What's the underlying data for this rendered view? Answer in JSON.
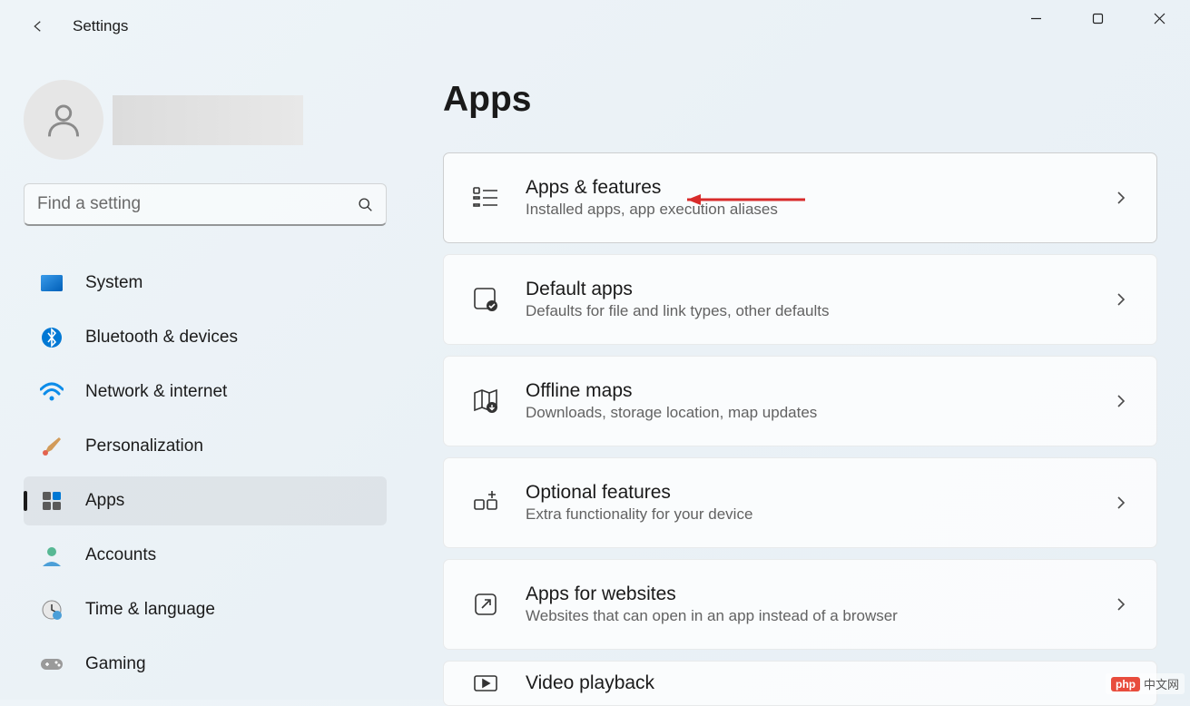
{
  "app_title": "Settings",
  "search": {
    "placeholder": "Find a setting"
  },
  "nav": [
    {
      "label": "System",
      "icon": "system"
    },
    {
      "label": "Bluetooth & devices",
      "icon": "bluetooth"
    },
    {
      "label": "Network & internet",
      "icon": "wifi"
    },
    {
      "label": "Personalization",
      "icon": "brush"
    },
    {
      "label": "Apps",
      "icon": "apps",
      "active": true
    },
    {
      "label": "Accounts",
      "icon": "account"
    },
    {
      "label": "Time & language",
      "icon": "time"
    },
    {
      "label": "Gaming",
      "icon": "gaming"
    }
  ],
  "page_title": "Apps",
  "cards": [
    {
      "title": "Apps & features",
      "desc": "Installed apps, app execution aliases",
      "icon": "apps-list",
      "highlighted": true,
      "arrow": true
    },
    {
      "title": "Default apps",
      "desc": "Defaults for file and link types, other defaults",
      "icon": "default-apps"
    },
    {
      "title": "Offline maps",
      "desc": "Downloads, storage location, map updates",
      "icon": "map"
    },
    {
      "title": "Optional features",
      "desc": "Extra functionality for your device",
      "icon": "optional"
    },
    {
      "title": "Apps for websites",
      "desc": "Websites that can open in an app instead of a browser",
      "icon": "websites"
    },
    {
      "title": "Video playback",
      "desc": "",
      "icon": "video"
    }
  ],
  "watermark": {
    "logo": "php",
    "text": "中文网"
  }
}
